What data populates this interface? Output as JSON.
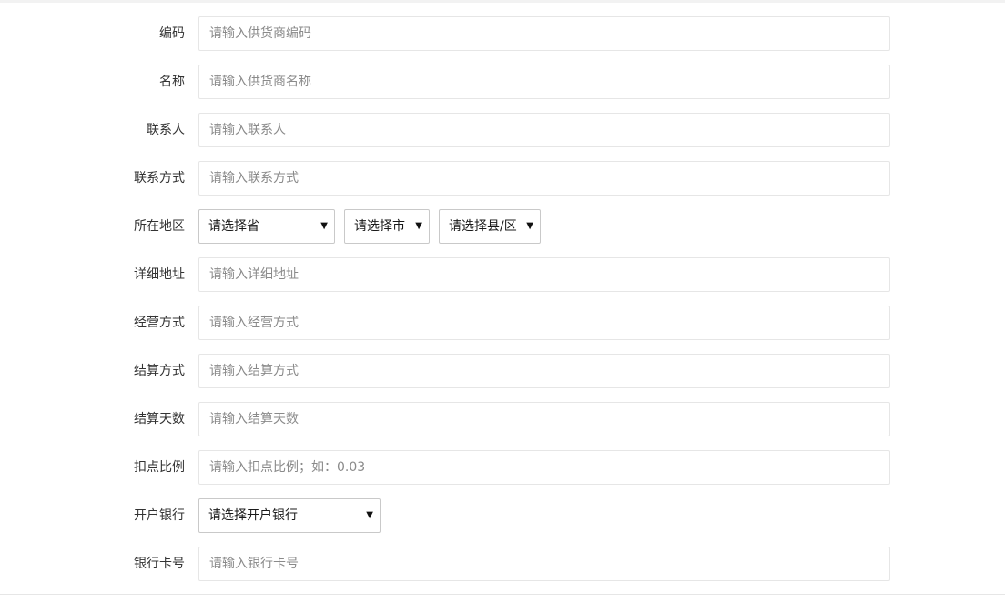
{
  "form": {
    "code": {
      "label": "编码",
      "placeholder": "请输入供货商编码"
    },
    "name": {
      "label": "名称",
      "placeholder": "请输入供货商名称"
    },
    "contact": {
      "label": "联系人",
      "placeholder": "请输入联系人"
    },
    "phone": {
      "label": "联系方式",
      "placeholder": "请输入联系方式"
    },
    "region": {
      "label": "所在地区",
      "province": "请选择省",
      "city": "请选择市",
      "county": "请选择县/区",
      "caret_icon": "caret-down-icon"
    },
    "address": {
      "label": "详细地址",
      "placeholder": "请输入详细地址"
    },
    "business_mode": {
      "label": "经营方式",
      "placeholder": "请输入经营方式"
    },
    "settlement_mode": {
      "label": "结算方式",
      "placeholder": "请输入结算方式"
    },
    "settlement_days": {
      "label": "结算天数",
      "placeholder": "请输入结算天数"
    },
    "deduction_ratio": {
      "label": "扣点比例",
      "placeholder": "请输入扣点比例；如：0.03"
    },
    "bank": {
      "label": "开户银行",
      "selected": "请选择开户银行"
    },
    "card_no": {
      "label": "银行卡号",
      "placeholder": "请输入银行卡号"
    }
  },
  "icons": {
    "caret": "▼"
  }
}
